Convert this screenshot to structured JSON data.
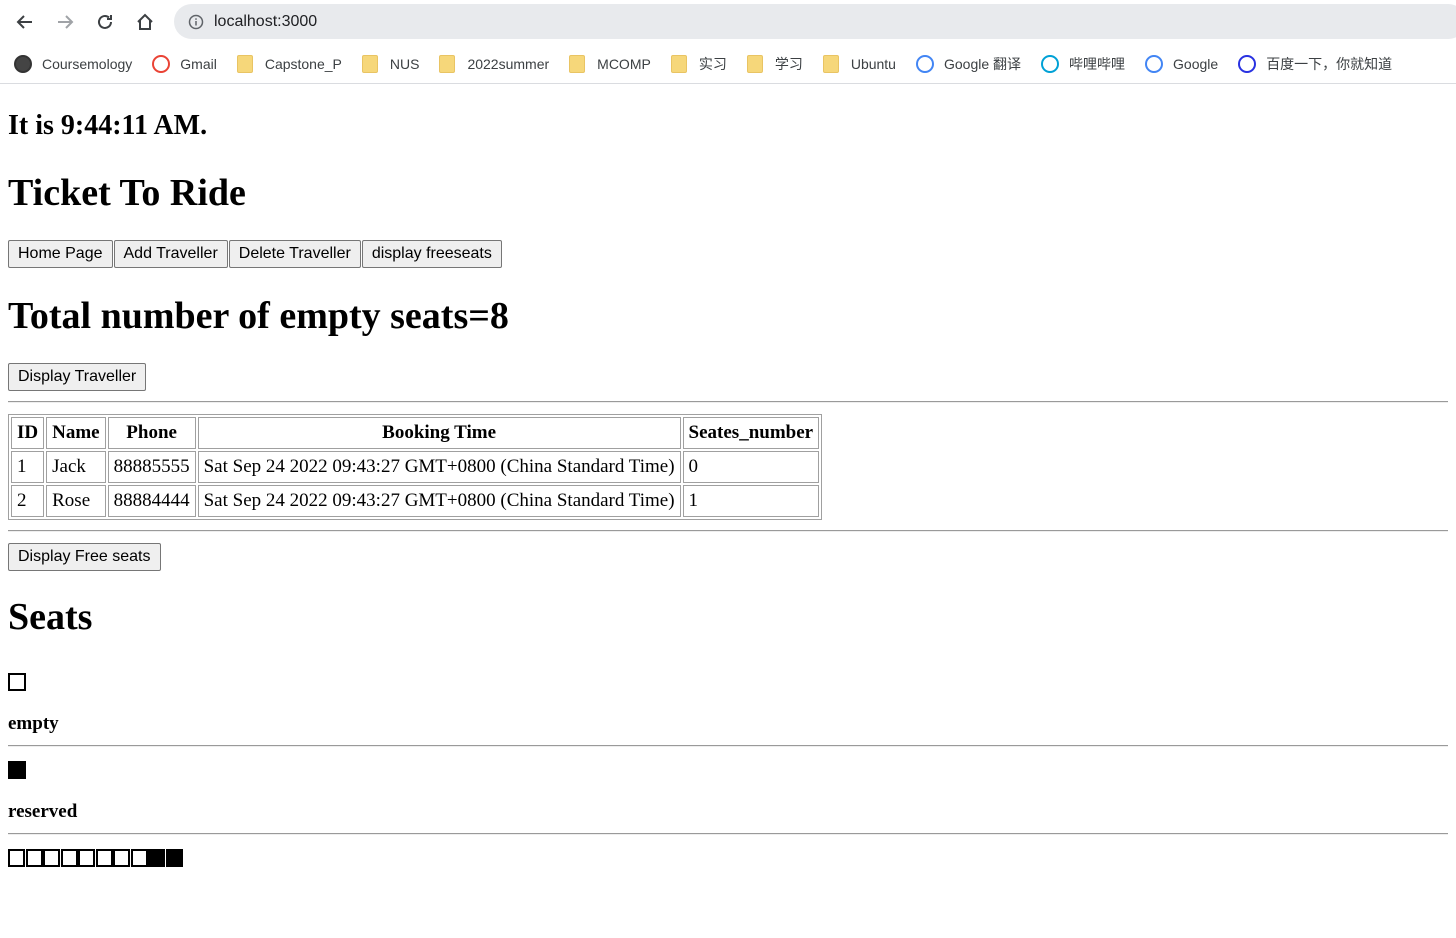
{
  "browser": {
    "url": "localhost:3000",
    "bookmarks": [
      {
        "label": "Coursemology",
        "icon": "coursemology-icon"
      },
      {
        "label": "Gmail",
        "icon": "gmail-icon"
      },
      {
        "label": "Capstone_P",
        "icon": "folder-icon"
      },
      {
        "label": "NUS",
        "icon": "folder-icon"
      },
      {
        "label": "2022summer",
        "icon": "folder-icon"
      },
      {
        "label": "MCOMP",
        "icon": "folder-icon"
      },
      {
        "label": "实习",
        "icon": "folder-icon"
      },
      {
        "label": "学习",
        "icon": "folder-icon"
      },
      {
        "label": "Ubuntu",
        "icon": "folder-icon"
      },
      {
        "label": "Google 翻译",
        "icon": "google-translate-icon"
      },
      {
        "label": "哔哩哔哩",
        "icon": "bilibili-icon"
      },
      {
        "label": "Google",
        "icon": "google-icon"
      },
      {
        "label": "百度一下，你就知道",
        "icon": "baidu-icon"
      }
    ]
  },
  "page": {
    "clock": "It is 9:44:11 AM.",
    "title": "Ticket To Ride",
    "nav_buttons": [
      "Home Page",
      "Add Traveller",
      "Delete Traveller",
      "display freeseats"
    ],
    "empty_seats": "Total number of empty seats=8",
    "display_traveller_label": "Display Traveller",
    "table": {
      "headers": [
        "ID",
        "Name",
        "Phone",
        "Booking Time",
        "Seates_number"
      ],
      "rows": [
        [
          "1",
          "Jack",
          "88885555",
          "Sat Sep 24 2022 09:43:27 GMT+0800 (China Standard Time)",
          "0"
        ],
        [
          "2",
          "Rose",
          "88884444",
          "Sat Sep 24 2022 09:43:27 GMT+0800 (China Standard Time)",
          "1"
        ]
      ]
    },
    "display_free_label": "Display Free seats",
    "seats_heading": "Seats",
    "legend_empty": "empty",
    "legend_reserved": "reserved",
    "seats": [
      "empty",
      "empty",
      "empty",
      "empty",
      "empty",
      "empty",
      "empty",
      "empty",
      "reserved",
      "reserved"
    ]
  }
}
